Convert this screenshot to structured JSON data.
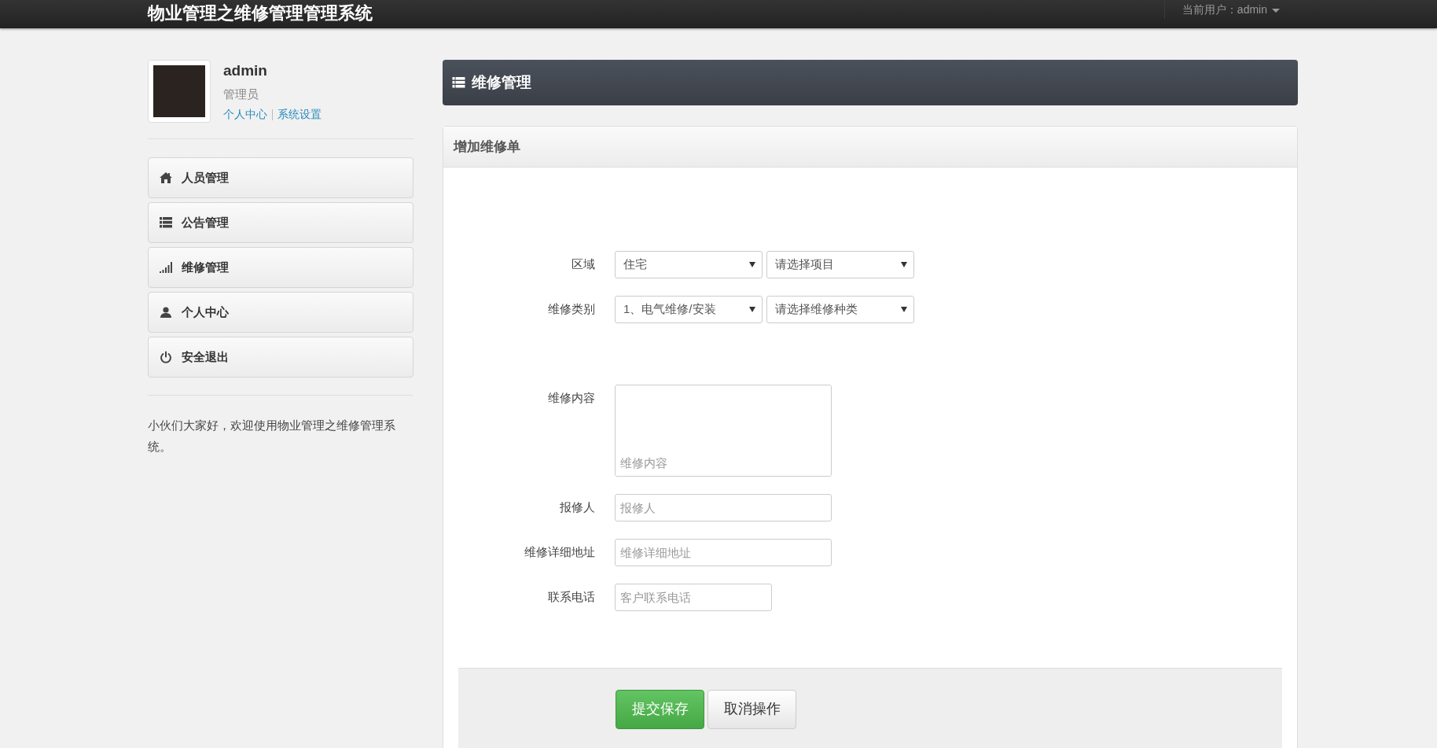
{
  "navbar": {
    "title": "物业管理之维修管理管理系统",
    "current_user": "当前用户：admin"
  },
  "profile": {
    "name": "admin",
    "role": "管理员",
    "links": [
      "个人中心",
      "系统设置"
    ]
  },
  "menu": [
    {
      "label": "人员管理",
      "kind": "home"
    },
    {
      "label": "公告管理",
      "kind": "list"
    },
    {
      "label": "维修管理",
      "kind": "signal"
    },
    {
      "label": "个人中心",
      "kind": "user"
    },
    {
      "label": "安全退出",
      "kind": "power"
    }
  ],
  "welcome": "小伙们大家好，欢迎使用物业管理之维修管理系统。",
  "page_header": "维修管理",
  "panel": {
    "title": "增加维修单",
    "fields": [
      {
        "kind": "selects",
        "label": "区域",
        "selects": [
          "住宅",
          "请选择项目"
        ]
      },
      {
        "kind": "selects",
        "label": "维修类别",
        "selects": [
          "1、电气维修/安装",
          "请选择维修种类"
        ]
      },
      {
        "kind": "textarea",
        "label": "维修内容",
        "placeholder": "维修内容"
      },
      {
        "kind": "input",
        "label": "报修人",
        "placeholder": "报修人"
      },
      {
        "kind": "input",
        "label": "维修详细地址",
        "placeholder": "维修详细地址"
      },
      {
        "kind": "short_input",
        "label": "联系电话",
        "placeholder": "客户联系电话"
      }
    ],
    "buttons": [
      {
        "label": "提交保存",
        "kind": "primary"
      },
      {
        "label": "取消操作",
        "kind": "default"
      }
    ]
  }
}
